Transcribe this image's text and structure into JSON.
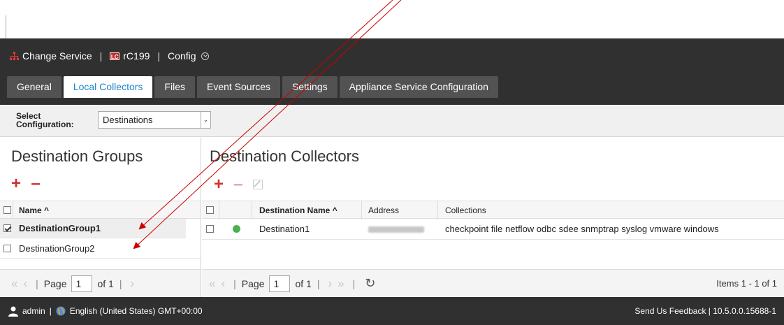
{
  "header": {
    "change_service": "Change Service",
    "separator": "|",
    "service_name": "rC199",
    "service_badge": "LC",
    "config_label": "Config"
  },
  "tabs": [
    {
      "label": "General",
      "active": false
    },
    {
      "label": "Local Collectors",
      "active": true
    },
    {
      "label": "Files",
      "active": false
    },
    {
      "label": "Event Sources",
      "active": false
    },
    {
      "label": "Settings",
      "active": false
    },
    {
      "label": "Appliance Service Configuration",
      "active": false
    }
  ],
  "select_config": {
    "label_line1": "Select",
    "label_line2": "Configuration:",
    "value": "Destinations"
  },
  "left_panel": {
    "title": "Destination Groups",
    "column_name": "Name ^",
    "rows": [
      {
        "name": "DestinationGroup1",
        "checked": true,
        "selected": true
      },
      {
        "name": "DestinationGroup2",
        "checked": false,
        "selected": false
      }
    ],
    "pager": {
      "page_label": "Page",
      "page_value": "1",
      "of_label": "of 1"
    }
  },
  "right_panel": {
    "title": "Destination Collectors",
    "columns": {
      "name": "Destination Name ^",
      "address": "Address",
      "collections": "Collections"
    },
    "rows": [
      {
        "name": "Destination1",
        "status_color": "#4caf50",
        "collections": "checkpoint file netflow odbc sdee snmptrap syslog vmware windows"
      }
    ],
    "pager": {
      "page_label": "Page",
      "page_value": "1",
      "of_label": "of 1",
      "items": "Items 1 - 1 of 1"
    }
  },
  "footer": {
    "user": "admin",
    "separator": "|",
    "locale": "English (United States) GMT+00:00",
    "feedback": "Send Us Feedback | 10.5.0.0.15688-1"
  },
  "colors": {
    "accent": "#1e86c9",
    "header_bg": "#303030",
    "add_red": "#d32f2f",
    "annotation_red": "#cc0000"
  }
}
